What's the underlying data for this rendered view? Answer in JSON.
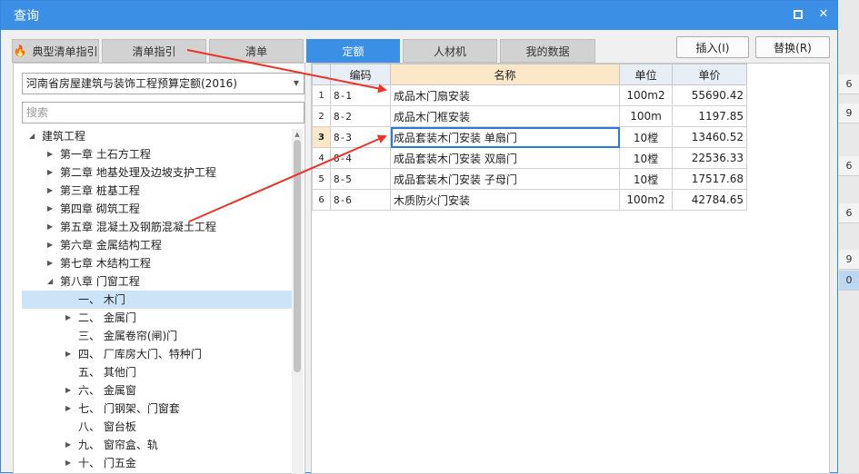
{
  "window": {
    "title": "查询"
  },
  "background": {
    "right_cells": [
      "6",
      "9",
      "6",
      "6",
      "9",
      "0"
    ]
  },
  "tabs": [
    {
      "label": "典型清单指引",
      "active": false,
      "has_icon": true
    },
    {
      "label": "清单指引",
      "active": false
    },
    {
      "label": "清单",
      "active": false
    },
    {
      "label": "定额",
      "active": true
    },
    {
      "label": "人材机",
      "active": false
    },
    {
      "label": "我的数据",
      "active": false
    }
  ],
  "buttons": {
    "insert": "插入(I)",
    "replace": "替换(R)"
  },
  "left": {
    "select_value": "河南省房屋建筑与装饰工程预算定额(2016)",
    "search_placeholder": "搜索",
    "tree": [
      {
        "label": "建筑工程",
        "level": 0,
        "arrow": "expanded"
      },
      {
        "label": "第一章 土石方工程",
        "level": 1,
        "arrow": "collapsed"
      },
      {
        "label": "第二章 地基处理及边坡支护工程",
        "level": 1,
        "arrow": "collapsed"
      },
      {
        "label": "第三章 桩基工程",
        "level": 1,
        "arrow": "collapsed"
      },
      {
        "label": "第四章 砌筑工程",
        "level": 1,
        "arrow": "collapsed"
      },
      {
        "label": "第五章 混凝土及钢筋混凝土工程",
        "level": 1,
        "arrow": "collapsed"
      },
      {
        "label": "第六章 金属结构工程",
        "level": 1,
        "arrow": "collapsed"
      },
      {
        "label": "第七章 木结构工程",
        "level": 1,
        "arrow": "collapsed"
      },
      {
        "label": "第八章 门窗工程",
        "level": 1,
        "arrow": "expanded"
      },
      {
        "label": "一、 木门",
        "level": 2,
        "arrow": "none",
        "selected": true
      },
      {
        "label": "二、 金属门",
        "level": 2,
        "arrow": "collapsed"
      },
      {
        "label": "三、 金属卷帘(闸)门",
        "level": 2,
        "arrow": "none"
      },
      {
        "label": "四、 厂库房大门、特种门",
        "level": 2,
        "arrow": "collapsed"
      },
      {
        "label": "五、 其他门",
        "level": 2,
        "arrow": "none"
      },
      {
        "label": "六、 金属窗",
        "level": 2,
        "arrow": "collapsed"
      },
      {
        "label": "七、 门钢架、门窗套",
        "level": 2,
        "arrow": "collapsed"
      },
      {
        "label": "八、 窗台板",
        "level": 2,
        "arrow": "none"
      },
      {
        "label": "九、 窗帘盒、轨",
        "level": 2,
        "arrow": "collapsed"
      },
      {
        "label": "十、 门五金",
        "level": 2,
        "arrow": "collapsed"
      }
    ]
  },
  "table": {
    "headers": {
      "code": "编码",
      "name": "名称",
      "unit": "单位",
      "price": "单价"
    },
    "rows": [
      {
        "num": "1",
        "code": "8-1",
        "name": "成品木门扇安装",
        "unit": "100m2",
        "price": "55690.42"
      },
      {
        "num": "2",
        "code": "8-2",
        "name": "成品木门框安装",
        "unit": "100m",
        "price": "1197.85"
      },
      {
        "num": "3",
        "code": "8-3",
        "name": "成品套装木门安装 单扇门",
        "unit": "10樘",
        "price": "13460.52",
        "current": true
      },
      {
        "num": "4",
        "code": "8-4",
        "name": "成品套装木门安装 双扇门",
        "unit": "10樘",
        "price": "22536.33"
      },
      {
        "num": "5",
        "code": "8-5",
        "name": "成品套装木门安装 子母门",
        "unit": "10樘",
        "price": "17517.68"
      },
      {
        "num": "6",
        "code": "8-6",
        "name": "木质防火门安装",
        "unit": "100m2",
        "price": "42784.65"
      }
    ]
  },
  "colors": {
    "accent": "#3b8fe5",
    "annotation_arrow": "#e8342a",
    "selection": "#cce4f7",
    "header_highlight": "#fde7c9"
  }
}
